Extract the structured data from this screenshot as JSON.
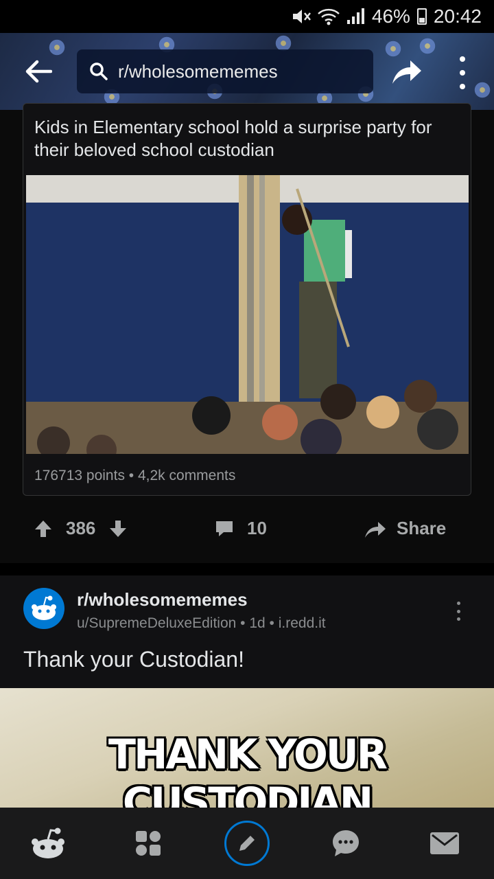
{
  "status_bar": {
    "battery": "46%",
    "time": "20:42"
  },
  "header": {
    "search_text": "r/wholesomememes"
  },
  "crosspost": {
    "title": "Kids in Elementary school hold a surprise party for their beloved school custodian",
    "points": "176713 points",
    "comments": "4,2k comments"
  },
  "actions": {
    "score": "386",
    "comments": "10",
    "share": "Share"
  },
  "post": {
    "subreddit": "r/wholesomememes",
    "author": "u/SupremeDeluxeEdition",
    "age": "1d",
    "domain": "i.redd.it",
    "title": "Thank your Custodian!",
    "meme_caption": "THANK YOUR CUSTODIAN"
  },
  "colors": {
    "accent": "#0079d3",
    "background": "#0b0b0b",
    "card": "#111113"
  },
  "nav": {
    "items": [
      "home-icon",
      "communities-icon",
      "compose-icon",
      "chat-icon",
      "inbox-icon"
    ]
  }
}
